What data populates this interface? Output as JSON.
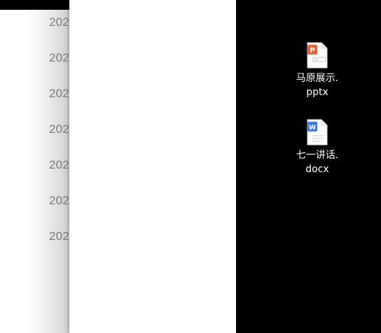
{
  "left_window": {
    "dates": [
      "202",
      "202",
      "202",
      "202",
      "202",
      "202",
      "202"
    ]
  },
  "desktop": {
    "icons": [
      {
        "name_line1": "马原展示.",
        "name_line2": "pptx",
        "icon": "pptx-file-icon",
        "badge_letter": "P",
        "accent": "#E8643C"
      },
      {
        "name_line1": "七一讲话.",
        "name_line2": "docx",
        "icon": "docx-file-icon",
        "badge_letter": "W",
        "accent": "#3B7BEA"
      }
    ]
  }
}
